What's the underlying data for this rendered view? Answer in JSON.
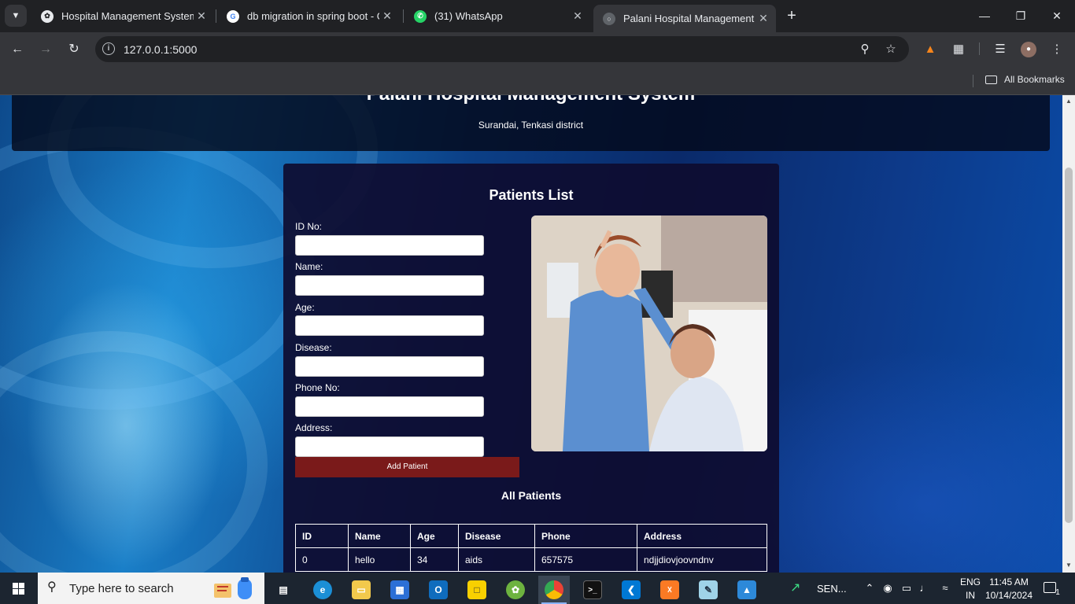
{
  "browser": {
    "tabs": [
      {
        "title": "Hospital Management System C",
        "favicon": "chatgpt-icon",
        "active": false
      },
      {
        "title": "db migration in spring boot - G",
        "favicon": "google-icon",
        "active": false
      },
      {
        "title": "(31) WhatsApp",
        "favicon": "whatsapp-icon",
        "active": false
      },
      {
        "title": "Palani Hospital Management Sy",
        "favicon": "globe-icon",
        "active": true
      }
    ],
    "url": "127.0.0.1:5000",
    "bookmarks_label": "All Bookmarks"
  },
  "page": {
    "header": {
      "title": "Palani Hospital Management System",
      "subtitle": "Surandai, Tenkasi district"
    },
    "form": {
      "title": "Patients List",
      "fields": [
        {
          "label": "ID No:",
          "value": ""
        },
        {
          "label": "Name:",
          "value": ""
        },
        {
          "label": "Age:",
          "value": ""
        },
        {
          "label": "Disease:",
          "value": ""
        },
        {
          "label": "Phone No:",
          "value": ""
        },
        {
          "label": "Address:",
          "value": ""
        }
      ],
      "submit_label": "Add Patient"
    },
    "table": {
      "title": "All Patients",
      "columns": [
        "ID",
        "Name",
        "Age",
        "Disease",
        "Phone",
        "Address"
      ],
      "rows": [
        [
          "0",
          "hello",
          "34",
          "aids",
          "657575",
          "ndjjdiovjoovndnv"
        ]
      ]
    }
  },
  "taskbar": {
    "search_placeholder": "Type here to search",
    "tray_app_label": "SEN...",
    "language_top": "ENG",
    "language_bottom": "IN",
    "time": "11:45 AM",
    "date": "10/14/2024",
    "notification_count": "1"
  },
  "colors": {
    "chrome_dark": "#202124",
    "chrome_toolbar": "#35363a",
    "add_button": "#7a1a1a",
    "card_bg": "#0e0c30",
    "taskbar": "#1c2530"
  }
}
